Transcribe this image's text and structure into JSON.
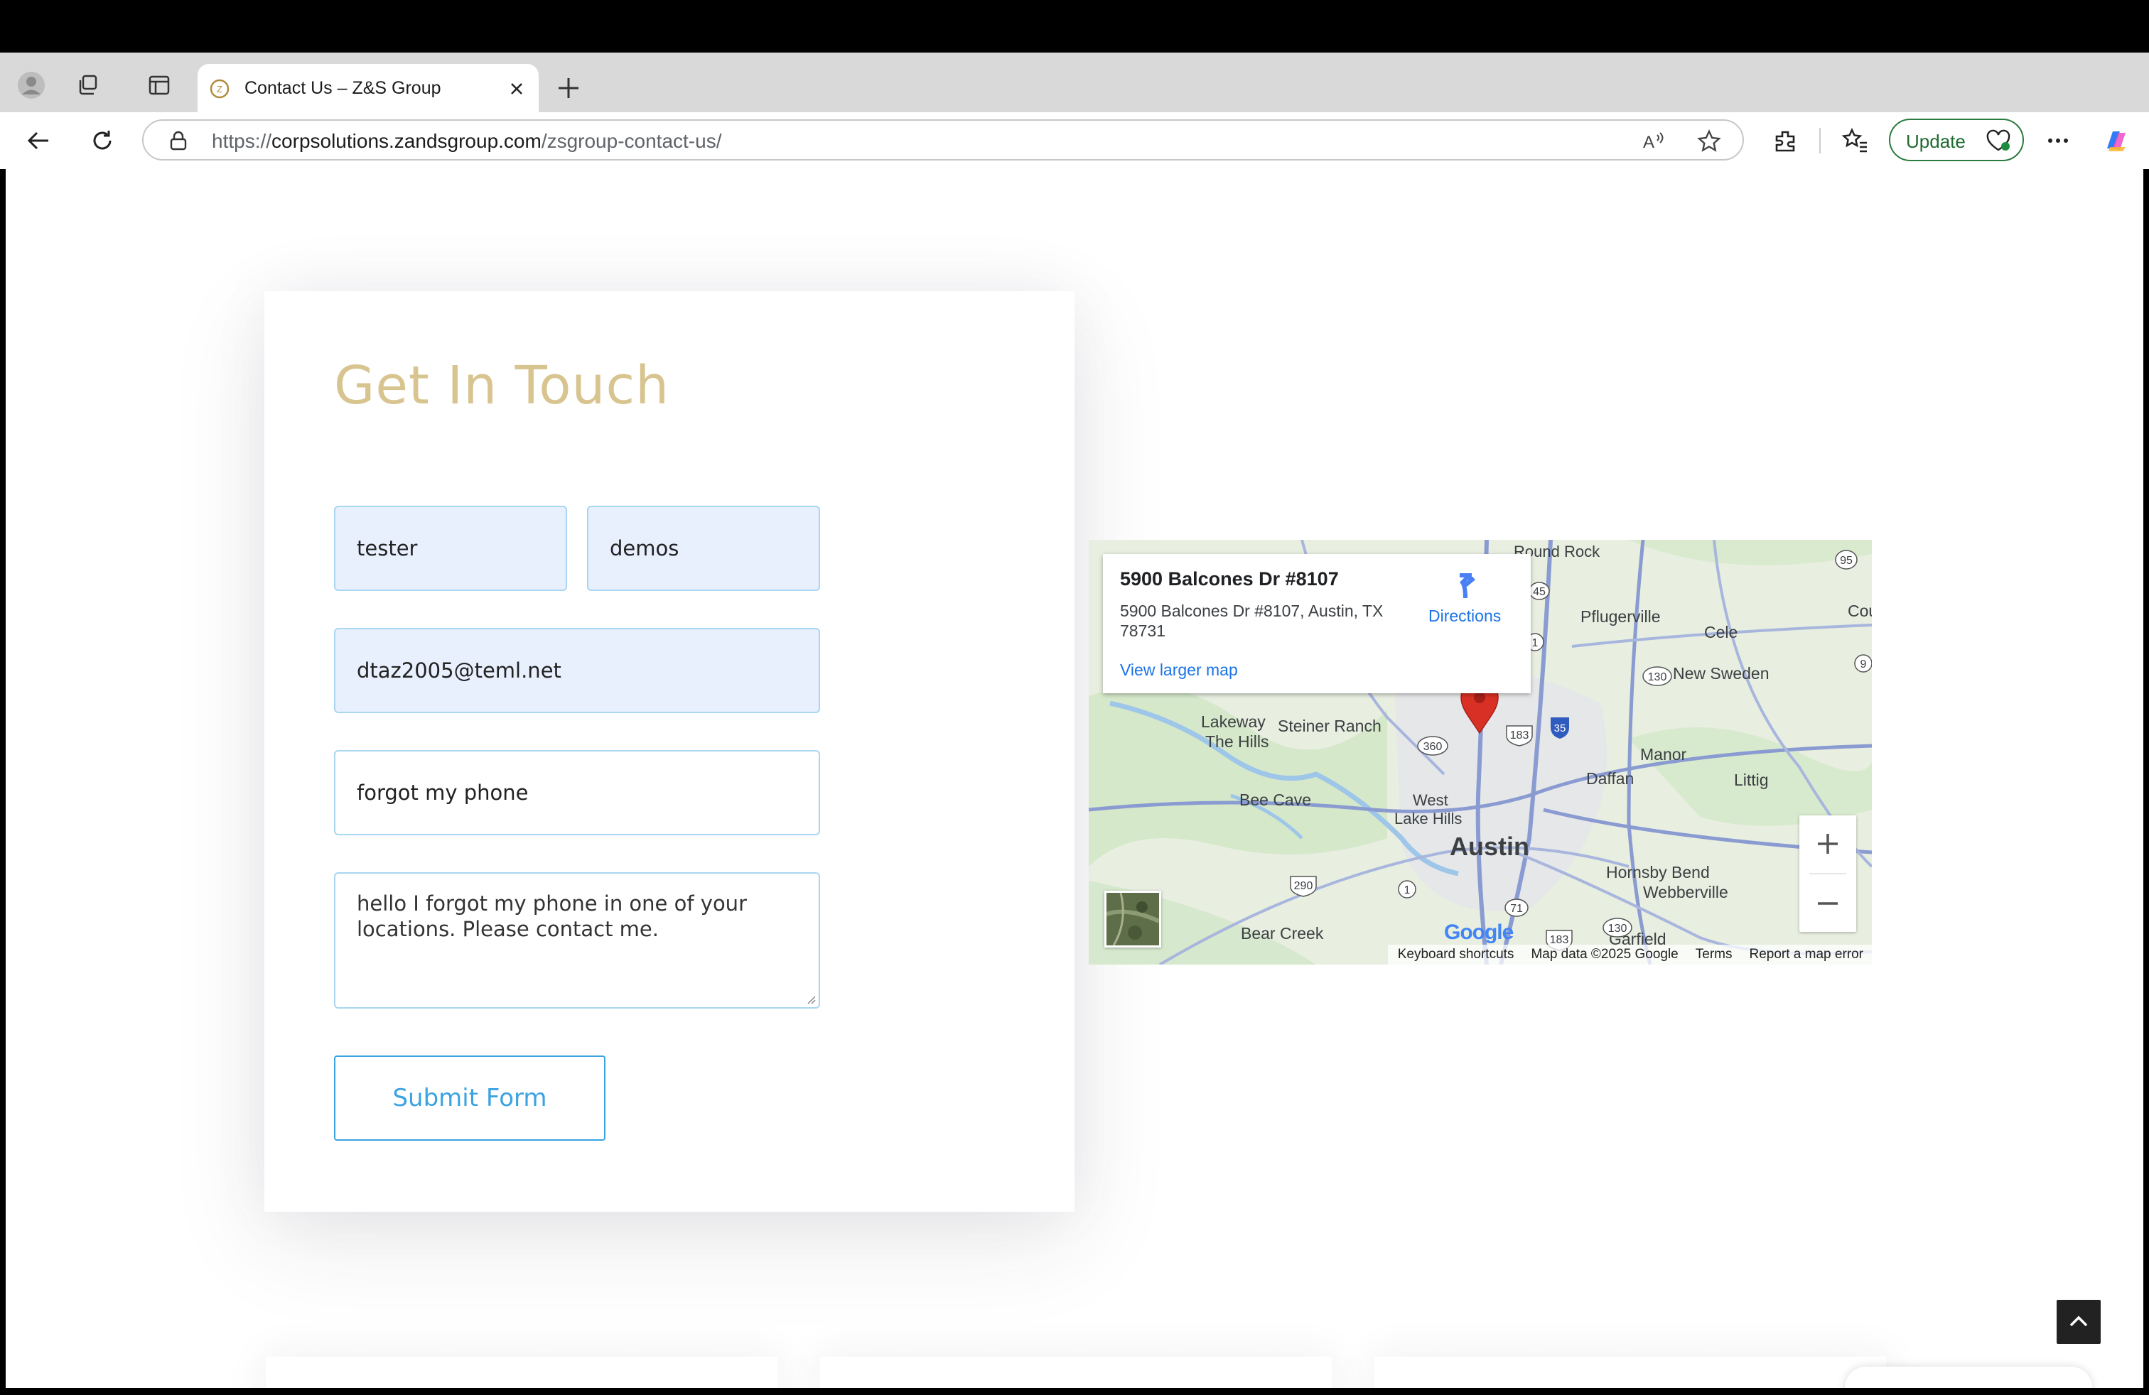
{
  "browser": {
    "tab_title": "Contact Us – Z&S Group",
    "url_prefix": "https://",
    "url_host": "corpsolutions.zandsgroup.com",
    "url_path": "/zsgroup-contact-us/",
    "update_label": "Update"
  },
  "form": {
    "heading": "Get In Touch",
    "first_name": "tester",
    "last_name": "demos",
    "email": "dtaz2005@teml.net",
    "subject": "forgot my phone",
    "message": "hello I forgot my phone in one of your locations. Please contact me.",
    "submit_label": "Submit Form"
  },
  "map": {
    "place_name": "5900 Balcones Dr #8107",
    "place_address": "5900 Balcones Dr #8107, Austin, TX 78731",
    "directions_label": "Directions",
    "view_larger_label": "View larger map",
    "zoom_in": "+",
    "zoom_out": "−",
    "footer": {
      "shortcuts": "Keyboard shortcuts",
      "map_data": "Map data ©2025 Google",
      "terms": "Terms",
      "report": "Report a map error"
    },
    "logo": "Google",
    "labels": {
      "round_rock": "Round Rock",
      "pflugerville": "Pflugerville",
      "cele": "Cele",
      "coupland": "Coupla",
      "new_sweden": "New Sweden",
      "lakeway": "Lakeway",
      "the_hills": "The Hills",
      "steiner_ranch": "Steiner Ranch",
      "manor": "Manor",
      "daffan": "Daffan",
      "littig": "Littig",
      "bee_cave": "Bee Cave",
      "west_lake_hills_1": "West",
      "west_lake_hills_2": "Lake Hills",
      "austin": "Austin",
      "hornsby_bend": "Hornsby Bend",
      "webberville": "Webberville",
      "bear_creek": "Bear Creek",
      "garfield": "Garfield",
      "hw_95": "95",
      "hw_45": "45",
      "hw_1a": "1",
      "hw_130a": "130",
      "hw_9": "9",
      "hw_35": "35",
      "hw_183a": "183",
      "hw_360": "360",
      "hw_290": "290",
      "hw_1b": "1",
      "hw_71": "71",
      "hw_183b": "183",
      "hw_130b": "130"
    }
  },
  "colors": {
    "heading": "#d8c48f",
    "field_border": "#a9d6f0",
    "autofill_bg": "#e8f0fe",
    "submit": "#3aa3e0",
    "pin": "#d93025"
  }
}
